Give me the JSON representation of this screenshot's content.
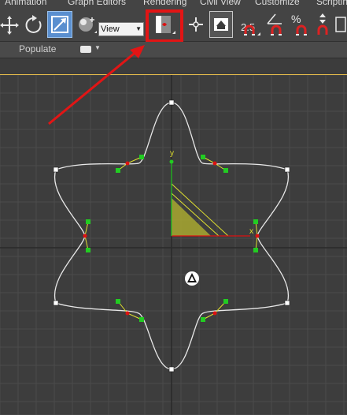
{
  "menubar": {
    "items": [
      "Animation",
      "Graph Editors",
      "Rendering",
      "Civil View",
      "Customize",
      "Scriptin"
    ]
  },
  "toolbar": {
    "reference_coordinate_system": "View",
    "snap_label": "2.5",
    "percent_label": "%",
    "highlight_color": "#e21515"
  },
  "ribbon": {
    "populate_label": "Populate"
  },
  "viewport": {
    "gizmo_x_label": "x",
    "gizmo_y_label": "y",
    "grid_color": "#4a4a4a",
    "spline_color": "#e8e8e8",
    "vertex_handle_color": "#22cc22",
    "axis_x_color": "#dd1111",
    "axis_y_color": "#22cc22"
  },
  "annotation": {
    "arrow_color": "#e21515"
  }
}
